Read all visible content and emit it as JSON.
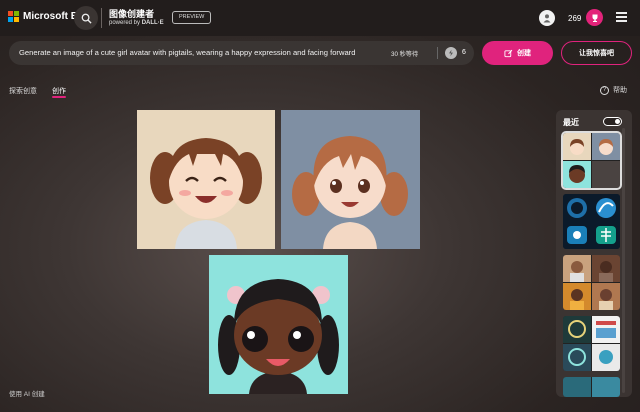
{
  "header": {
    "brand": "Microsoft Bing",
    "product_title": "图像创建者",
    "product_sub_prefix": "powered by ",
    "product_sub_brand": "DALL·E",
    "preview_badge": "PREVIEW",
    "coin_count": "269",
    "icons": [
      "search-icon",
      "user-avatar-icon",
      "trophy-icon",
      "hamburger-menu-icon"
    ]
  },
  "prompt": {
    "text": "Generate an image of a cute girl avatar with pigtails, wearing a happy expression and facing forward",
    "wait_label": "30 秒等待",
    "boost_count": "6",
    "create_label": "创建",
    "surprise_label": "让我惊喜吧"
  },
  "tabs": [
    {
      "label": "探索创意",
      "active": false
    },
    {
      "label": "创作",
      "active": true
    }
  ],
  "help_label": "帮助",
  "recent": {
    "title": "最近",
    "toggle_on": true
  },
  "footer": "使用 AI 创建",
  "colors": {
    "accent": "#e0237d",
    "topbar": "#221d1c",
    "prompt_bg": "#3a3533"
  }
}
